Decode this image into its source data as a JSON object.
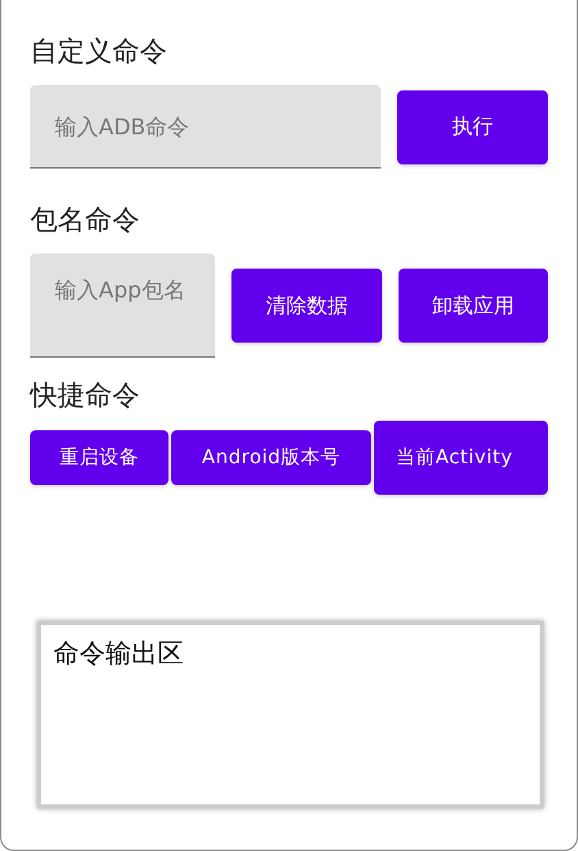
{
  "custom_command": {
    "heading": "自定义命令",
    "input": {
      "placeholder": "输入ADB命令"
    },
    "buttons": [
      "执行"
    ]
  },
  "package_command": {
    "heading": "包名命令",
    "input": {
      "placeholder": "输入App包名"
    },
    "buttons": [
      "清除数据",
      "卸载应用"
    ]
  },
  "quick_command": {
    "heading": "快捷命令",
    "buttons": [
      "重启设备",
      "Android版本号",
      "当前Activity"
    ]
  },
  "output": {
    "text": "命令输出区"
  }
}
